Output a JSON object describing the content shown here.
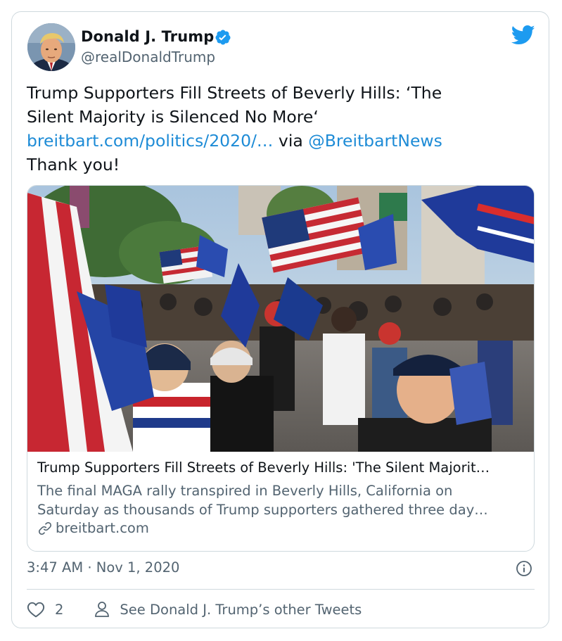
{
  "user": {
    "display_name": "Donald J. Trump",
    "handle": "@realDonaldTrump",
    "verified": true,
    "avatar_icon": "avatar-portrait"
  },
  "tweet": {
    "text_line1": "Trump Supporters Fill Streets of Beverly Hills: ‘The",
    "text_line2": "Silent Majority is Silenced No More‘",
    "link": "breitbart.com/politics/2020/…",
    "via": " via ",
    "mention": "@BreitbartNews",
    "text_line4": "Thank you!"
  },
  "link_card": {
    "title": "Trump Supporters Fill Streets of Beverly Hills: 'The Silent Majorit…",
    "desc_line1": "The final MAGA rally transpired in Beverly Hills, California on",
    "desc_line2": "Saturday as thousands of Trump supporters gathered three day…",
    "domain": "breitbart.com"
  },
  "meta": {
    "timestamp": "3:47 AM · Nov 1, 2020"
  },
  "actions": {
    "like_count": "2",
    "other_tweets_label": "See Donald J. Trump’s other Tweets"
  },
  "colors": {
    "link_blue": "#1d8bd6",
    "twitter_blue": "#1d9bf0",
    "secondary_text": "#536471",
    "border": "#cfd9de"
  },
  "icons": [
    "twitter-bird-icon",
    "verified-badge-icon",
    "link-icon",
    "info-icon",
    "heart-icon",
    "person-icon"
  ]
}
